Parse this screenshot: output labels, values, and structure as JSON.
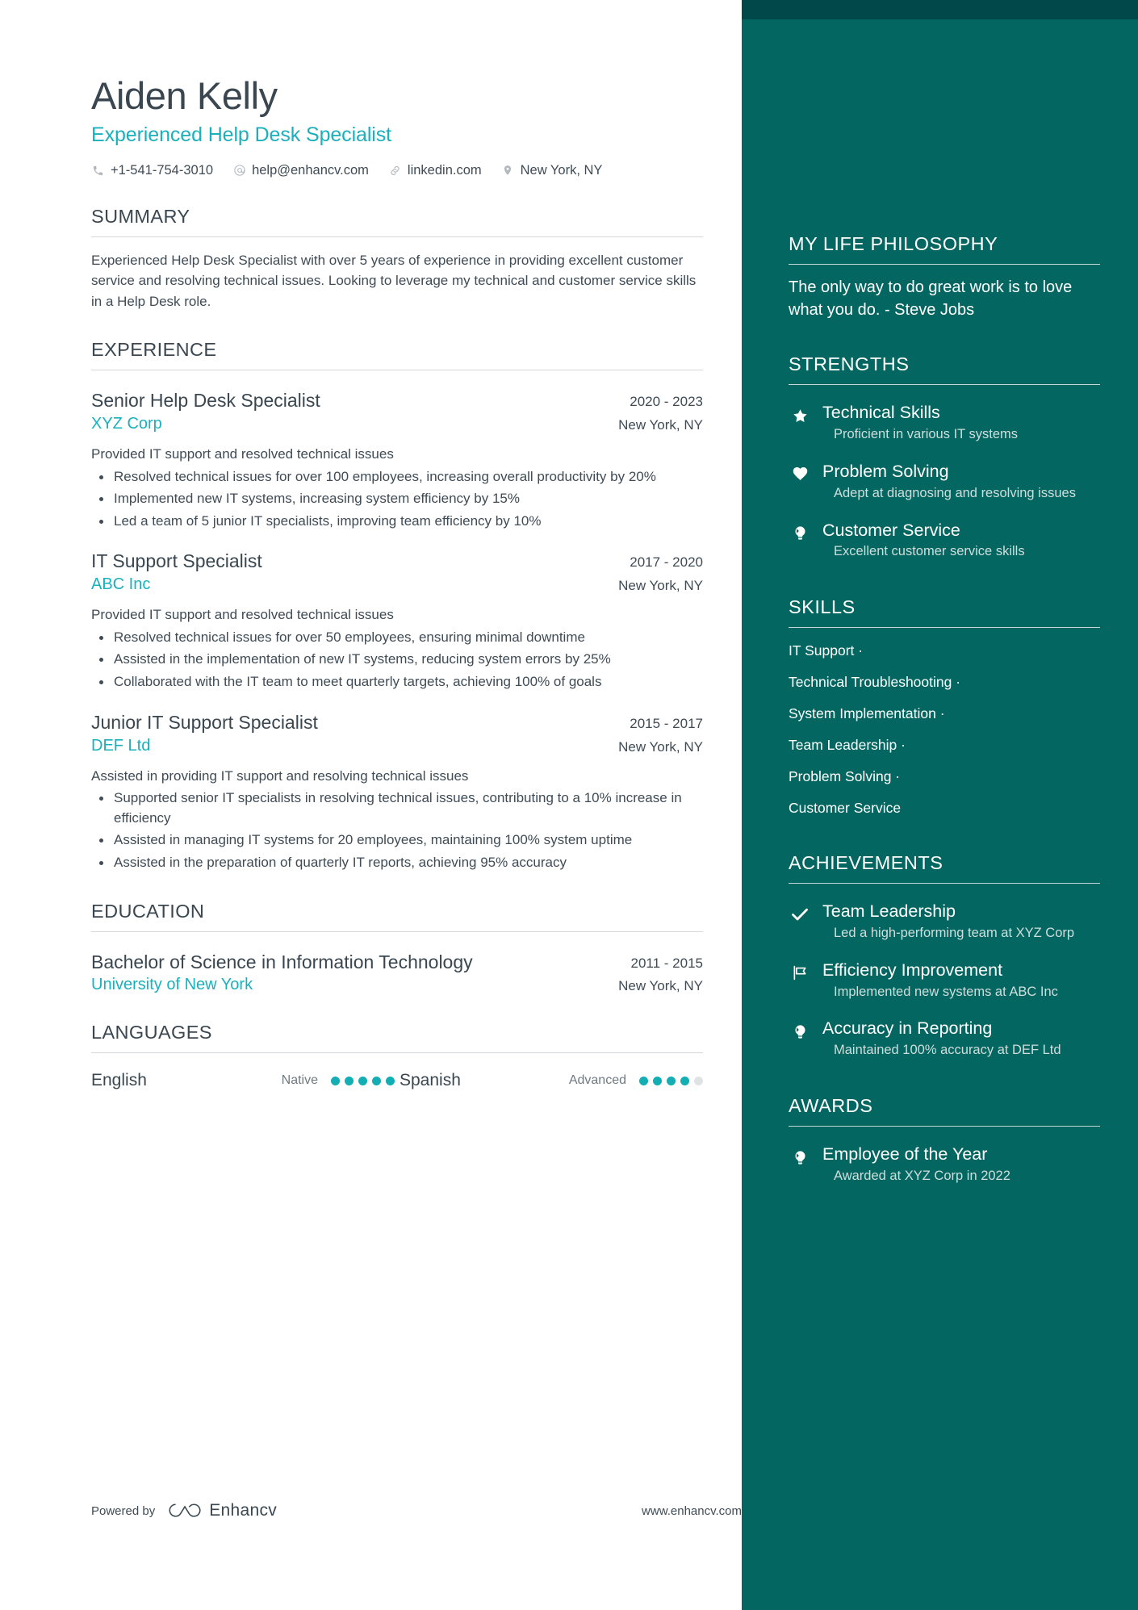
{
  "accent_colors": {
    "sidebar_bg": "#046660",
    "sidebar_top_strip": "#01484a",
    "accent_teal": "#1ab0bc",
    "heading_gray": "#3a4750",
    "body_gray": "#3f4b55"
  },
  "header": {
    "name": "Aiden Kelly",
    "job_title": "Experienced Help Desk Specialist",
    "contacts": [
      {
        "icon": "phone-icon",
        "text": "+1-541-754-3010"
      },
      {
        "icon": "email-icon",
        "text": "help@enhancv.com"
      },
      {
        "icon": "link-icon",
        "text": "linkedin.com"
      },
      {
        "icon": "location-pin-icon",
        "text": "New York, NY"
      }
    ]
  },
  "summary": {
    "title": "SUMMARY",
    "text": "Experienced Help Desk Specialist with over 5 years of experience in providing excellent customer service and resolving technical issues. Looking to leverage my technical and customer service skills in a Help Desk role."
  },
  "experience": {
    "title": "EXPERIENCE",
    "entries": [
      {
        "role": "Senior Help Desk Specialist",
        "dates": "2020 - 2023",
        "company": "XYZ Corp",
        "location": "New York, NY",
        "description": "Provided IT support and resolved technical issues",
        "bullets": [
          "Resolved technical issues for over 100 employees, increasing overall productivity by 20%",
          "Implemented new IT systems, increasing system efficiency by 15%",
          "Led a team of 5 junior IT specialists, improving team efficiency by 10%"
        ]
      },
      {
        "role": "IT Support Specialist",
        "dates": "2017 - 2020",
        "company": "ABC Inc",
        "location": "New York, NY",
        "description": "Provided IT support and resolved technical issues",
        "bullets": [
          "Resolved technical issues for over 50 employees, ensuring minimal downtime",
          "Assisted in the implementation of new IT systems, reducing system errors by 25%",
          "Collaborated with the IT team to meet quarterly targets, achieving 100% of goals"
        ]
      },
      {
        "role": "Junior IT Support Specialist",
        "dates": "2015 - 2017",
        "company": "DEF Ltd",
        "location": "New York, NY",
        "description": "Assisted in providing IT support and resolving technical issues",
        "bullets": [
          "Supported senior IT specialists in resolving technical issues, contributing to a 10% increase in efficiency",
          "Assisted in managing IT systems for 20 employees, maintaining 100% system uptime",
          "Assisted in the preparation of quarterly IT reports, achieving 95% accuracy"
        ]
      }
    ]
  },
  "education": {
    "title": "EDUCATION",
    "entries": [
      {
        "degree": "Bachelor of Science in Information Technology",
        "dates": "2011 - 2015",
        "school": "University of New York",
        "location": "New York, NY"
      }
    ]
  },
  "languages": {
    "title": "LANGUAGES",
    "items": [
      {
        "name": "English",
        "level": "Native",
        "filled": 5,
        "total": 5
      },
      {
        "name": "Spanish",
        "level": "Advanced",
        "filled": 4,
        "total": 5
      }
    ]
  },
  "footer": {
    "powered_by": "Powered by",
    "brand": "Enhancv",
    "website": "www.enhancv.com"
  },
  "sidebar": {
    "philosophy": {
      "title": "MY LIFE PHILOSOPHY",
      "quote": "The only way to do great work is to love what you do. - Steve Jobs"
    },
    "strengths": {
      "title": "STRENGTHS",
      "items": [
        {
          "icon": "star-icon",
          "title": "Technical Skills",
          "desc": "Proficient in various IT systems"
        },
        {
          "icon": "heart-icon",
          "title": "Problem Solving",
          "desc": "Adept at diagnosing and resolving issues"
        },
        {
          "icon": "lightbulb-icon",
          "title": "Customer Service",
          "desc": "Excellent customer service skills"
        }
      ]
    },
    "skills": {
      "title": "SKILLS",
      "items": [
        {
          "label": "IT Support",
          "sep": "·"
        },
        {
          "label": "Technical Troubleshooting",
          "sep": "·"
        },
        {
          "label": "System Implementation",
          "sep": "·"
        },
        {
          "label": "Team Leadership",
          "sep": "·"
        },
        {
          "label": "Problem Solving",
          "sep": "·"
        },
        {
          "label": "Customer Service",
          "sep": ""
        }
      ]
    },
    "achievements": {
      "title": "ACHIEVEMENTS",
      "items": [
        {
          "icon": "check-icon",
          "title": "Team Leadership",
          "desc": "Led a high-performing team at XYZ Corp"
        },
        {
          "icon": "flag-icon",
          "title": "Efficiency Improvement",
          "desc": "Implemented new systems at ABC Inc"
        },
        {
          "icon": "lightbulb-icon",
          "title": "Accuracy in Reporting",
          "desc": "Maintained 100% accuracy at DEF Ltd"
        }
      ]
    },
    "awards": {
      "title": "AWARDS",
      "items": [
        {
          "icon": "lightbulb-icon",
          "title": "Employee of the Year",
          "desc": "Awarded at XYZ Corp in 2022"
        }
      ]
    }
  }
}
